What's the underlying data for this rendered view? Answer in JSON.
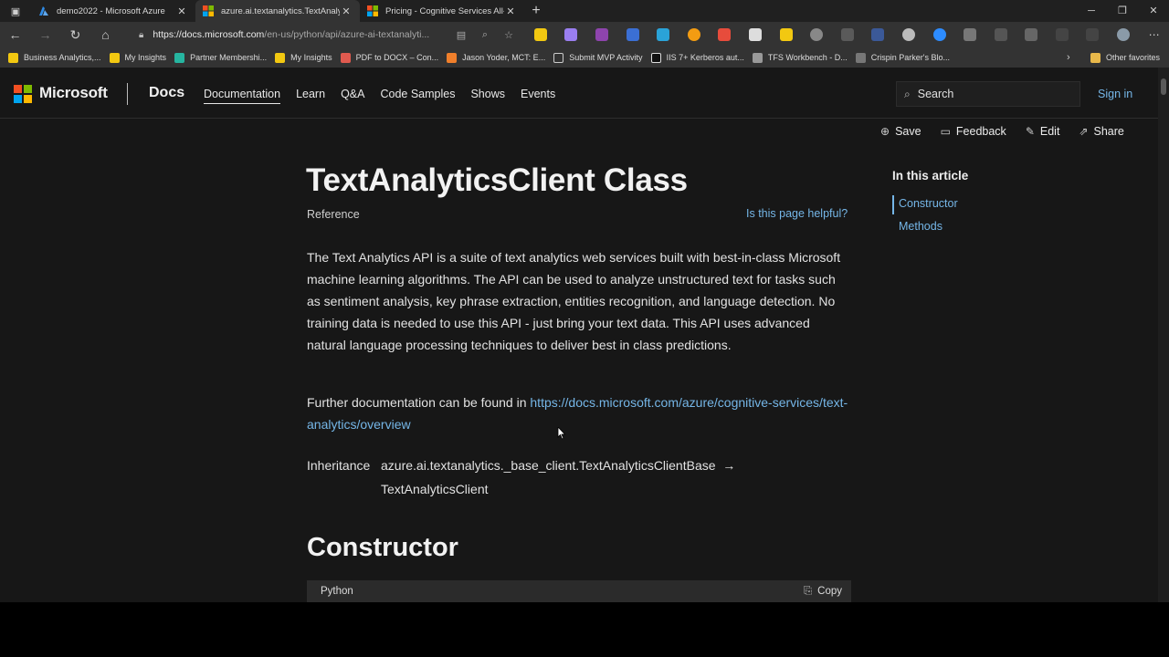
{
  "browser": {
    "tabs": [
      {
        "title": "demo2022 - Microsoft Azure",
        "favicon_color": "#2f8be6"
      },
      {
        "title": "azure.ai.textanalytics.TextAnalytic",
        "favicon_color": "#f5a623"
      },
      {
        "title": "Pricing - Cognitive Services All-In",
        "favicon_color": "#f5a623"
      }
    ],
    "url_host": "https://docs.microsoft.com",
    "url_rest": "/en-us/python/api/azure-ai-textanalyti...",
    "favorites": [
      {
        "label": "Business Analytics,...",
        "color": "#f2c811"
      },
      {
        "label": "My Insights",
        "color": "#f2c811"
      },
      {
        "label": "Partner Membershi...",
        "color": "#26b5a0"
      },
      {
        "label": "My Insights",
        "color": "#f2c811"
      },
      {
        "label": "PDF to DOCX – Con...",
        "color": "#e05a4f"
      },
      {
        "label": "Jason Yoder, MCT: E...",
        "color": "#f07f2b"
      },
      {
        "label": "Submit MVP Activity",
        "color": "#cccccc"
      },
      {
        "label": "IIS 7+ Kerberos aut...",
        "color": "#111111"
      },
      {
        "label": "TFS Workbench - D...",
        "color": "#999999"
      },
      {
        "label": "Crispin Parker's Blo...",
        "color": "#777777"
      }
    ],
    "other_favorites": "Other favorites"
  },
  "site": {
    "brand": "Microsoft",
    "section": "Docs",
    "nav": [
      "Documentation",
      "Learn",
      "Q&A",
      "Code Samples",
      "Shows",
      "Events"
    ],
    "search_placeholder": "Search",
    "sign_in": "Sign in",
    "actions": {
      "save": "Save",
      "feedback": "Feedback",
      "edit": "Edit",
      "share": "Share"
    }
  },
  "article": {
    "title": "TextAnalyticsClient Class",
    "subtitle": "Reference",
    "helpful": "Is this page helpful?",
    "intro": "The Text Analytics API is a suite of text analytics web services built with best-in-class Microsoft machine learning algorithms. The API can be used to analyze unstructured text for tasks such as sentiment analysis, key phrase extraction, entities recognition, and language detection. No training data is needed to use this API - just bring your text data. This API uses advanced natural language processing techniques to deliver best in class predictions.",
    "further_prefix": "Further documentation can be found in ",
    "further_link": "https://docs.microsoft.com/azure/cognitive-services/text-analytics/overview",
    "inheritance_label": "Inheritance",
    "inheritance_base": "azure.ai.textanalytics._base_client.TextAnalyticsClientBase",
    "inheritance_derived": "TextAnalyticsClient",
    "constructor_heading": "Constructor",
    "code_lang": "Python",
    "copy_label": "Copy"
  },
  "toc": {
    "title": "In this article",
    "items": [
      "Constructor",
      "Methods"
    ]
  }
}
